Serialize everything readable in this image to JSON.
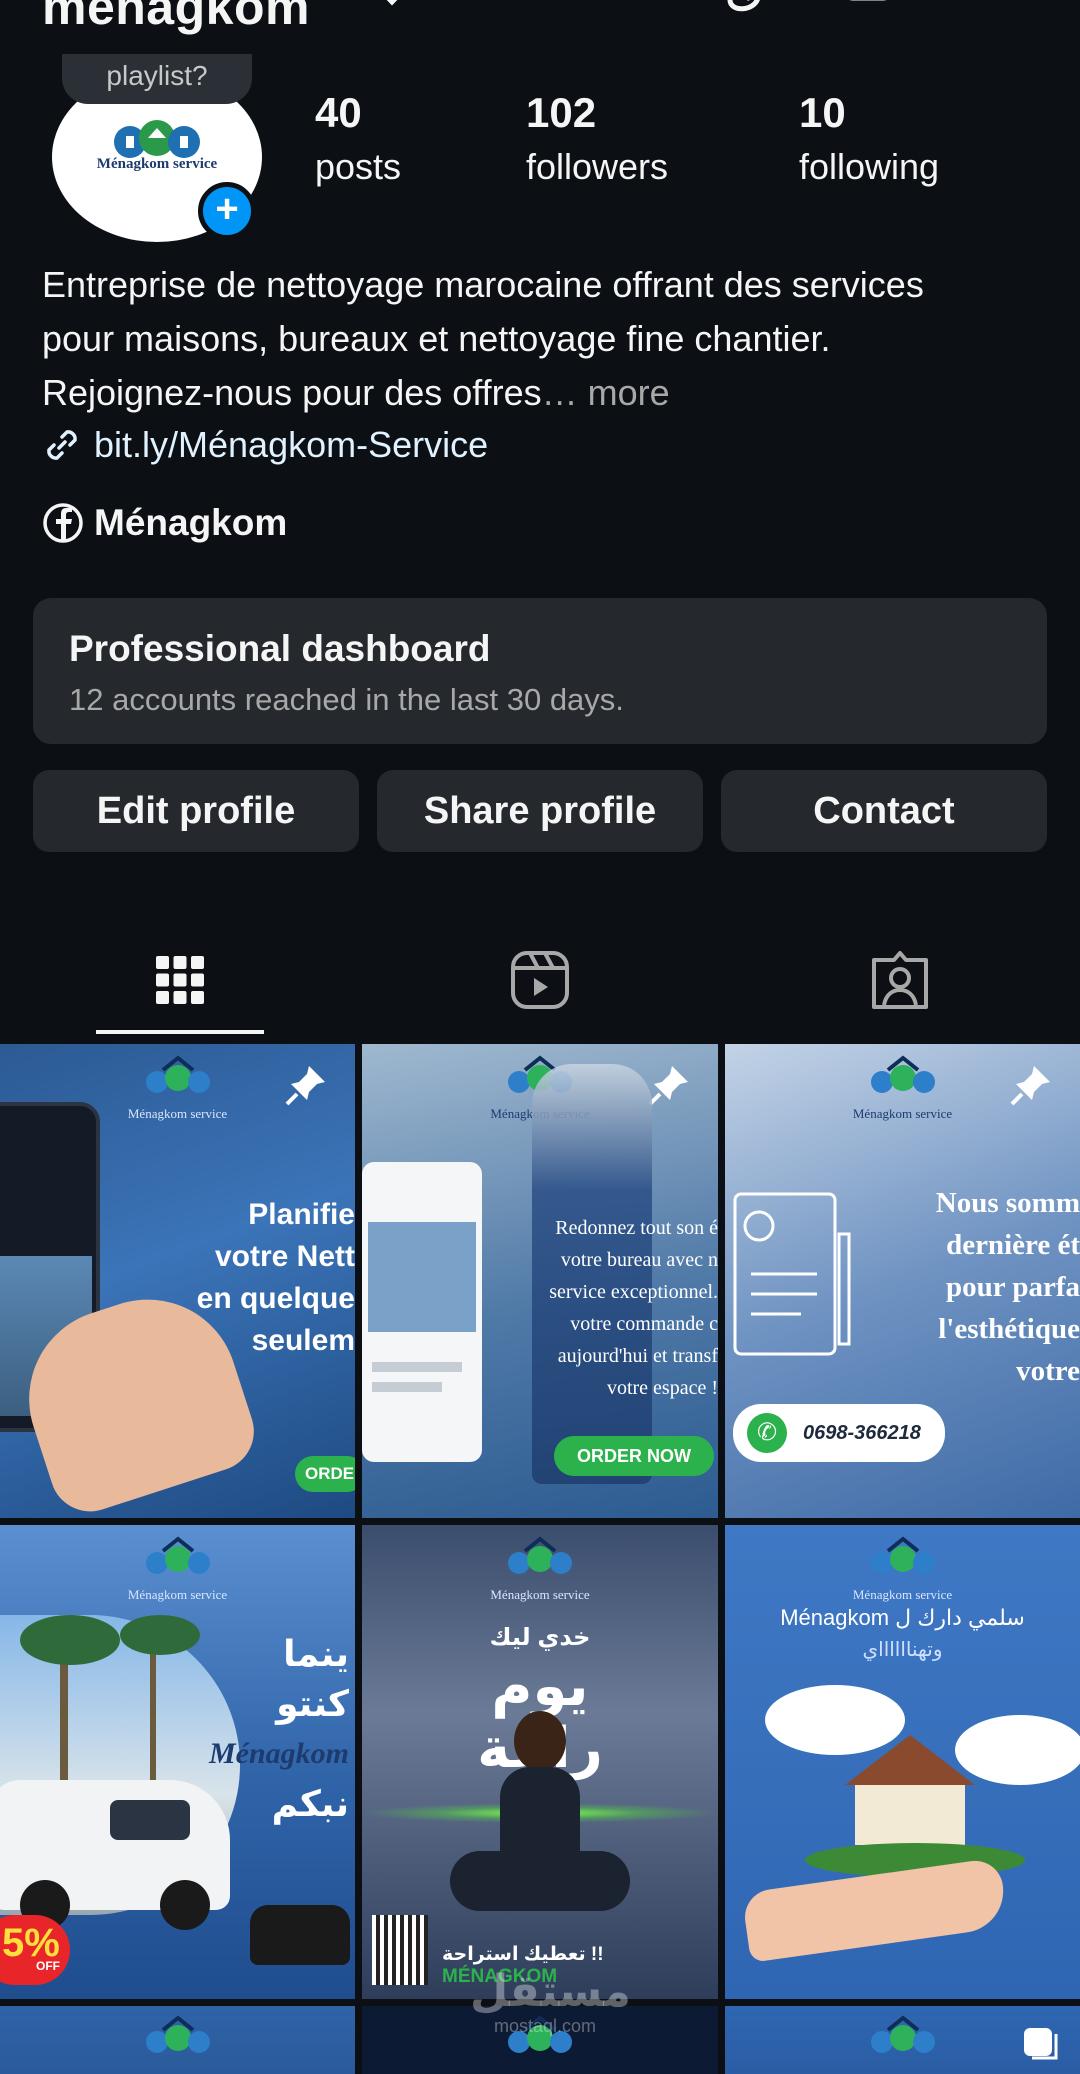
{
  "header": {
    "username": "ménagkom"
  },
  "profile": {
    "note": "playlist?",
    "avatar_text": "Ménagkom service",
    "stats": [
      {
        "num": "40",
        "label": "posts"
      },
      {
        "num": "102",
        "label": "followers"
      },
      {
        "num": "10",
        "label": "following"
      }
    ],
    "bio_lines": [
      "Entreprise de nettoyage marocaine offrant des services",
      "pour maisons, bureaux et nettoyage fine chantier.",
      "Rejoignez-nous pour des offres"
    ],
    "bio_more": "… more",
    "link": "bit.ly/Ménagkom-Service",
    "facebook_name": "Ménagkom"
  },
  "dashboard": {
    "title": "Professional dashboard",
    "subtitle": "12 accounts reached in the last 30 days."
  },
  "buttons": {
    "edit": "Edit profile",
    "share": "Share profile",
    "contact": "Contact"
  },
  "tabs": {
    "active": "grid",
    "items": [
      "grid-icon",
      "reels-icon",
      "tagged-icon"
    ]
  },
  "posts": {
    "p1": {
      "brand": "Ménagkom service",
      "lines": [
        "Planifie",
        "votre Nett",
        "en quelque",
        "seulem"
      ],
      "cta": "ORDE",
      "pinned": true
    },
    "p2": {
      "brand": "Ménagkom service",
      "lines": [
        "Redonnez tout son é",
        "votre bureau avec n",
        "service exceptionnel.",
        "votre commande c",
        "aujourd'hui et transf",
        "votre espace !"
      ],
      "cta": "ORDER NOW",
      "pinned": true
    },
    "p3": {
      "brand": "Ménagkom service",
      "lines": [
        "Nous somm",
        "dernière ét",
        "pour parfa",
        "l'esthétique",
        "votre"
      ],
      "phone": "0698-366218",
      "pinned": true
    },
    "p4": {
      "brand": "Ménagkom service",
      "lines": [
        "ينما",
        "كنتو",
        "Ménagkom",
        "نبكم"
      ],
      "badge": "5%",
      "badge_sub": "OFF"
    },
    "p5": {
      "brand": "Ménagkom service",
      "lines": [
        "خدي ليك",
        "يوم",
        "راحة"
      ],
      "footer": "تعطيك استراحة !!",
      "footer_brand": "MÉNAGKOM"
    },
    "p6": {
      "brand": "Ménagkom service",
      "headline": "Ménagkom سلمي دارك ل",
      "sub": "وتهنااااااي"
    }
  },
  "watermark": {
    "ar": "مستقل",
    "en": "mostaql.com"
  },
  "colors": {
    "background": "#0c1014",
    "card": "#25292e",
    "accent": "#0095f6",
    "link": "#e0f1ff",
    "muted": "#a8a8a8"
  }
}
